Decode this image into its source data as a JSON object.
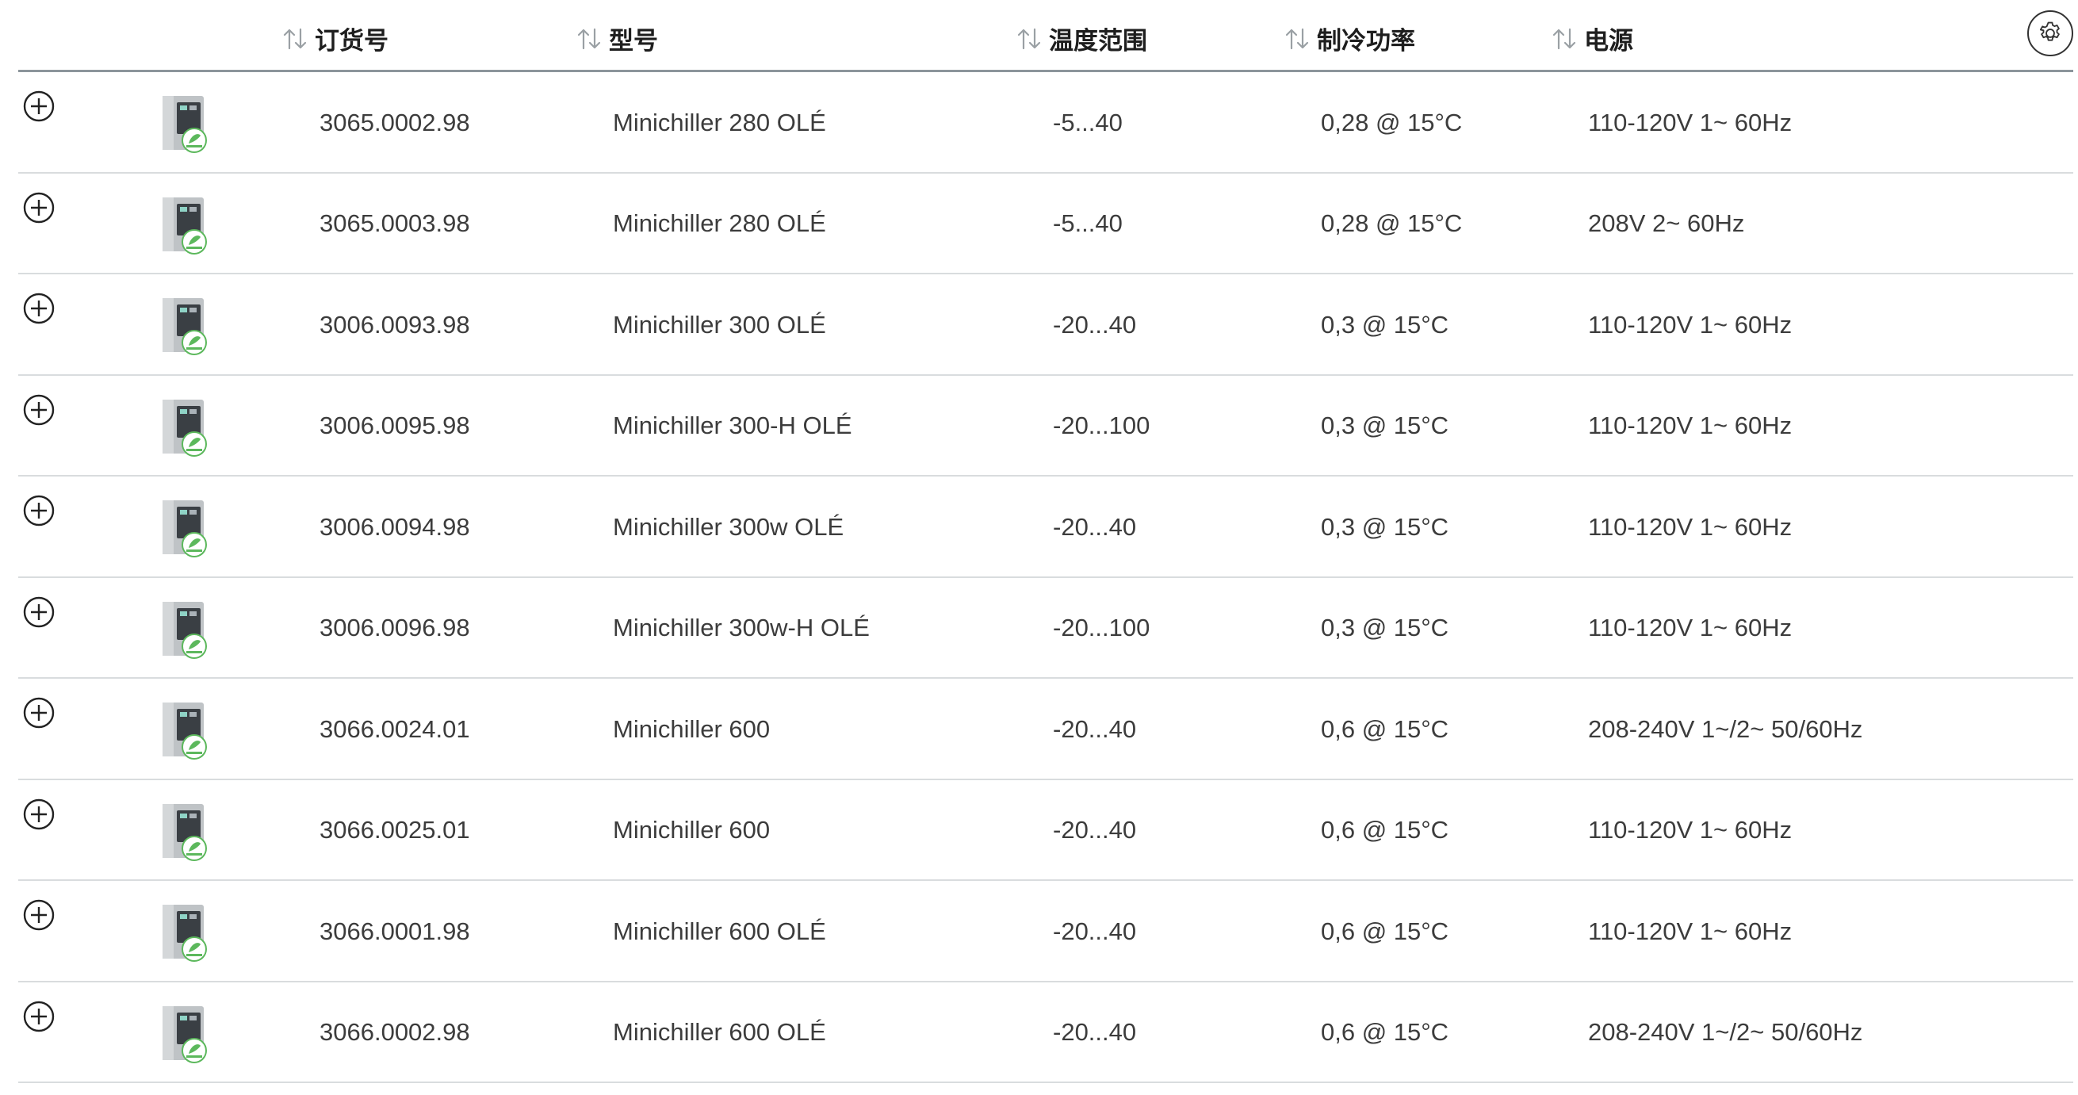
{
  "header": {
    "columns": [
      {
        "label": "订货号"
      },
      {
        "label": "型号"
      },
      {
        "label": "温度范围"
      },
      {
        "label": "制冷功率"
      },
      {
        "label": "电源"
      }
    ],
    "settings_icon": "gear-icon",
    "sort_icon": "sort-arrows-icon"
  },
  "rows": [
    {
      "order_no": "3065.0002.98",
      "model": "Minichiller 280 OLÉ",
      "temp_range": "-5...40",
      "cooling_power": "0,28 @ 15°C",
      "power_supply": "110-120V 1~ 60Hz"
    },
    {
      "order_no": "3065.0003.98",
      "model": "Minichiller 280 OLÉ",
      "temp_range": "-5...40",
      "cooling_power": "0,28 @ 15°C",
      "power_supply": "208V 2~ 60Hz"
    },
    {
      "order_no": "3006.0093.98",
      "model": "Minichiller 300 OLÉ",
      "temp_range": "-20...40",
      "cooling_power": "0,3 @ 15°C",
      "power_supply": "110-120V 1~ 60Hz"
    },
    {
      "order_no": "3006.0095.98",
      "model": "Minichiller 300-H OLÉ",
      "temp_range": "-20...100",
      "cooling_power": "0,3 @ 15°C",
      "power_supply": "110-120V 1~ 60Hz"
    },
    {
      "order_no": "3006.0094.98",
      "model": "Minichiller 300w OLÉ",
      "temp_range": "-20...40",
      "cooling_power": "0,3 @ 15°C",
      "power_supply": "110-120V 1~ 60Hz"
    },
    {
      "order_no": "3006.0096.98",
      "model": "Minichiller 300w-H OLÉ",
      "temp_range": "-20...100",
      "cooling_power": "0,3 @ 15°C",
      "power_supply": "110-120V 1~ 60Hz"
    },
    {
      "order_no": "3066.0024.01",
      "model": "Minichiller 600",
      "temp_range": "-20...40",
      "cooling_power": "0,6 @ 15°C",
      "power_supply": "208-240V 1~/2~ 50/60Hz"
    },
    {
      "order_no": "3066.0025.01",
      "model": "Minichiller 600",
      "temp_range": "-20...40",
      "cooling_power": "0,6 @ 15°C",
      "power_supply": "110-120V 1~ 60Hz"
    },
    {
      "order_no": "3066.0001.98",
      "model": "Minichiller 600 OLÉ",
      "temp_range": "-20...40",
      "cooling_power": "0,6 @ 15°C",
      "power_supply": "110-120V 1~ 60Hz"
    },
    {
      "order_no": "3066.0002.98",
      "model": "Minichiller 600 OLÉ",
      "temp_range": "-20...40",
      "cooling_power": "0,6 @ 15°C",
      "power_supply": "208-240V 1~/2~ 50/60Hz"
    }
  ],
  "icons": {
    "expand": "plus-circle-icon",
    "thumbnail": "product-image"
  },
  "colors": {
    "text": "#3c3c3c",
    "header_rule": "#8c959b",
    "row_rule": "#d9dcde",
    "badge": "#5cb85c"
  }
}
